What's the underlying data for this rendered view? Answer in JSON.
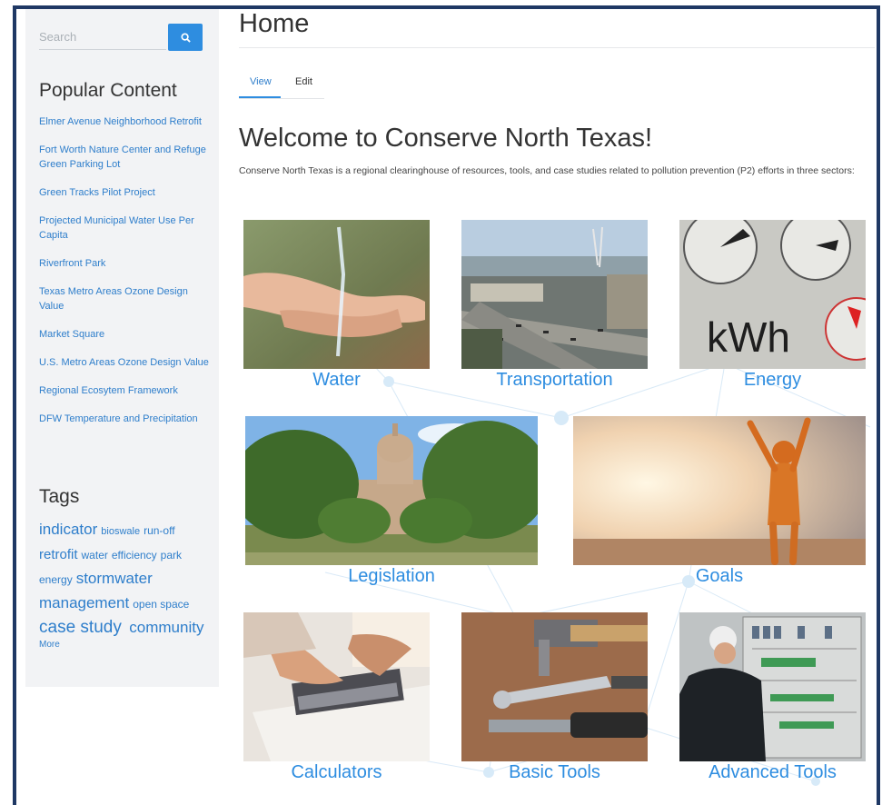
{
  "sidebar": {
    "search": {
      "placeholder": "Search"
    },
    "popular_heading": "Popular Content",
    "popular": [
      "Elmer Avenue Neighborhood Retrofit",
      "Fort Worth Nature Center and Refuge Green Parking Lot",
      "Green Tracks Pilot Project",
      "Projected Municipal Water Use Per Capita",
      "Riverfront Park",
      "Texas Metro Areas Ozone Design Value",
      "Market Square",
      "U.S. Metro Areas Ozone Design Value",
      "Regional Ecosytem Framework",
      "DFW Temperature and Precipitation"
    ],
    "tags_heading": "Tags",
    "tags": {
      "indicator": "indicator",
      "bioswale": "bioswale",
      "run_off": "run-off",
      "retrofit": "retrofit",
      "water": "water",
      "efficiency": "efficiency",
      "park": "park",
      "energy": "energy",
      "stormwater_management": "stormwater management",
      "open_space": "open space",
      "case_study": "case study",
      "community": "community"
    },
    "more": "More"
  },
  "main": {
    "page_title": "Home",
    "tabs": {
      "view": "View",
      "edit": "Edit"
    },
    "welcome": "Welcome to Conserve North Texas!",
    "intro": "Conserve North Texas is a regional clearinghouse of resources, tools, and case studies related to pollution prevention (P2) efforts in three sectors:",
    "tiles": {
      "water": "Water",
      "transportation": "Transportation",
      "energy": "Energy",
      "legislation": "Legislation",
      "goals": "Goals",
      "calculators": "Calculators",
      "basic_tools": "Basic Tools",
      "advanced_tools": "Advanced Tools"
    },
    "energy_meter_text": "kWh"
  },
  "colors": {
    "link": "#2e7ecb",
    "accent": "#2e8de0",
    "frame": "#1f3864"
  },
  "icons": {
    "search": "search-icon"
  }
}
